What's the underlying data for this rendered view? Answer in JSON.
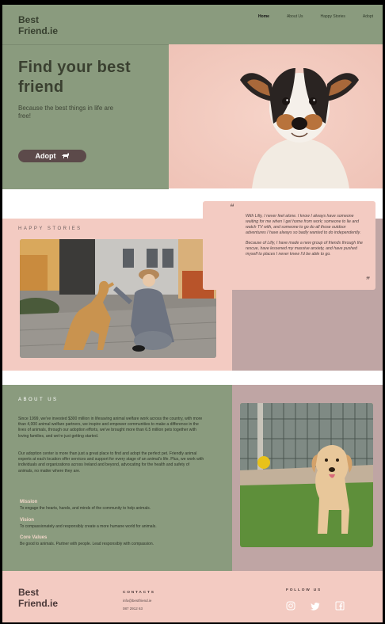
{
  "header": {
    "logo_line1": "Best",
    "logo_line2": "Friend.ie",
    "nav": [
      "Home",
      "About Us",
      "Happy Stories",
      "Adopt"
    ]
  },
  "hero": {
    "title_line1": "Find your best",
    "title_line2": "friend",
    "subtitle": "Because the best  things in life are free!",
    "button_label": "Adopt"
  },
  "stories": {
    "title": "HAPPY STORIES",
    "open_quote": "“",
    "close_quote": "”",
    "paragraph1": "With Lilly, I never feel alone. I know I always have someone waiting for me when I get home from work; someone to lie and watch TV with, and someone to go do all those outdoor adventures I have always so badly wanted to do independently.",
    "paragraph2": "Because of Lilly, I have made a new group of friends through the rescue, have lessened my massive anxiety, and have pushed myself to places I never knew I'd be able to go."
  },
  "about": {
    "title": "ABOUT US",
    "paragraph1": "Since 1999, we've invested $300 million in lifesaving animal welfare work across the country, with more than 4,000 animal welfare partners, we inspire and empower communities to make a difference in the lives of animals, through our adoption efforts, we've brought more than 6.5 million pets together with loving families, and we're just getting started.",
    "paragraph2": "Our adoption center is more than just a great place to find and adopt the perfect pet. Friendly animal experts at each location offer services and support for every stage of an animal's life. Plus, we work with individuals and organizations across Ireland and beyond, advocating for the health and safety of animals, no matter where they are.",
    "items": [
      {
        "heading": "Mission",
        "text": "To engage the hearts, hands, and minds of the community to help animals."
      },
      {
        "heading": "Vision",
        "text": "To compassionately and responsibly create a more humane world for animals."
      },
      {
        "heading": "Core Values",
        "text": "Be good to animals. Partner with people. Lead responsibly with compassion."
      }
    ]
  },
  "footer": {
    "logo_line1": "Best",
    "logo_line2": "Friend.ie",
    "contacts_title": "CONTACTS",
    "email": "info@bestfriend.ie",
    "phone": "087 2912 63",
    "follow_title": "FOLLOW US",
    "icons": [
      "instagram-icon",
      "twitter-icon",
      "facebook-icon"
    ]
  },
  "colors": {
    "sage": "#8a9b7e",
    "pink": "#f3cbc2",
    "mauve": "#bfa5a4",
    "button": "#5c4a4a"
  }
}
